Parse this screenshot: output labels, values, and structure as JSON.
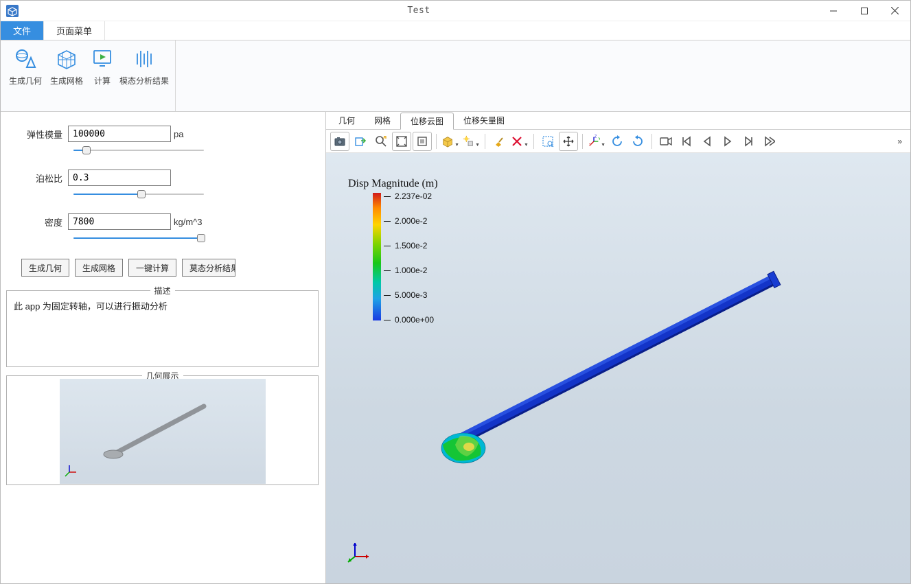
{
  "window": {
    "title": "Test"
  },
  "menu": {
    "file": "文件",
    "pagemenu": "页面菜单"
  },
  "ribbon": {
    "gen_geom": "生成几何",
    "gen_mesh": "生成网格",
    "compute": "计算",
    "modal_result": "模态分析结果"
  },
  "params": {
    "elastic_label": "弹性模量",
    "elastic_value": "100000",
    "elastic_unit": "pa",
    "poisson_label": "泊松比",
    "poisson_value": "0.3",
    "density_label": "密度",
    "density_value": "7800",
    "density_unit": "kg/m^3"
  },
  "buttons": {
    "gen_geom": "生成几何",
    "gen_mesh": "生成网格",
    "one_click": "一键计算",
    "modal": "莫态分析结果"
  },
  "desc_legend": "描述",
  "desc_text": "此 app 为固定转轴，可以进行振动分析",
  "geom_legend": "几何展示",
  "viewtabs": {
    "geom": "几何",
    "mesh": "网格",
    "disp_cloud": "位移云图",
    "disp_vector": "位移矢量图"
  },
  "plot": {
    "title": "Disp Magnitude (m)",
    "ticks": [
      "2.237e-02",
      "2.000e-2",
      "1.500e-2",
      "1.000e-2",
      "5.000e-3",
      "0.000e+00"
    ]
  }
}
